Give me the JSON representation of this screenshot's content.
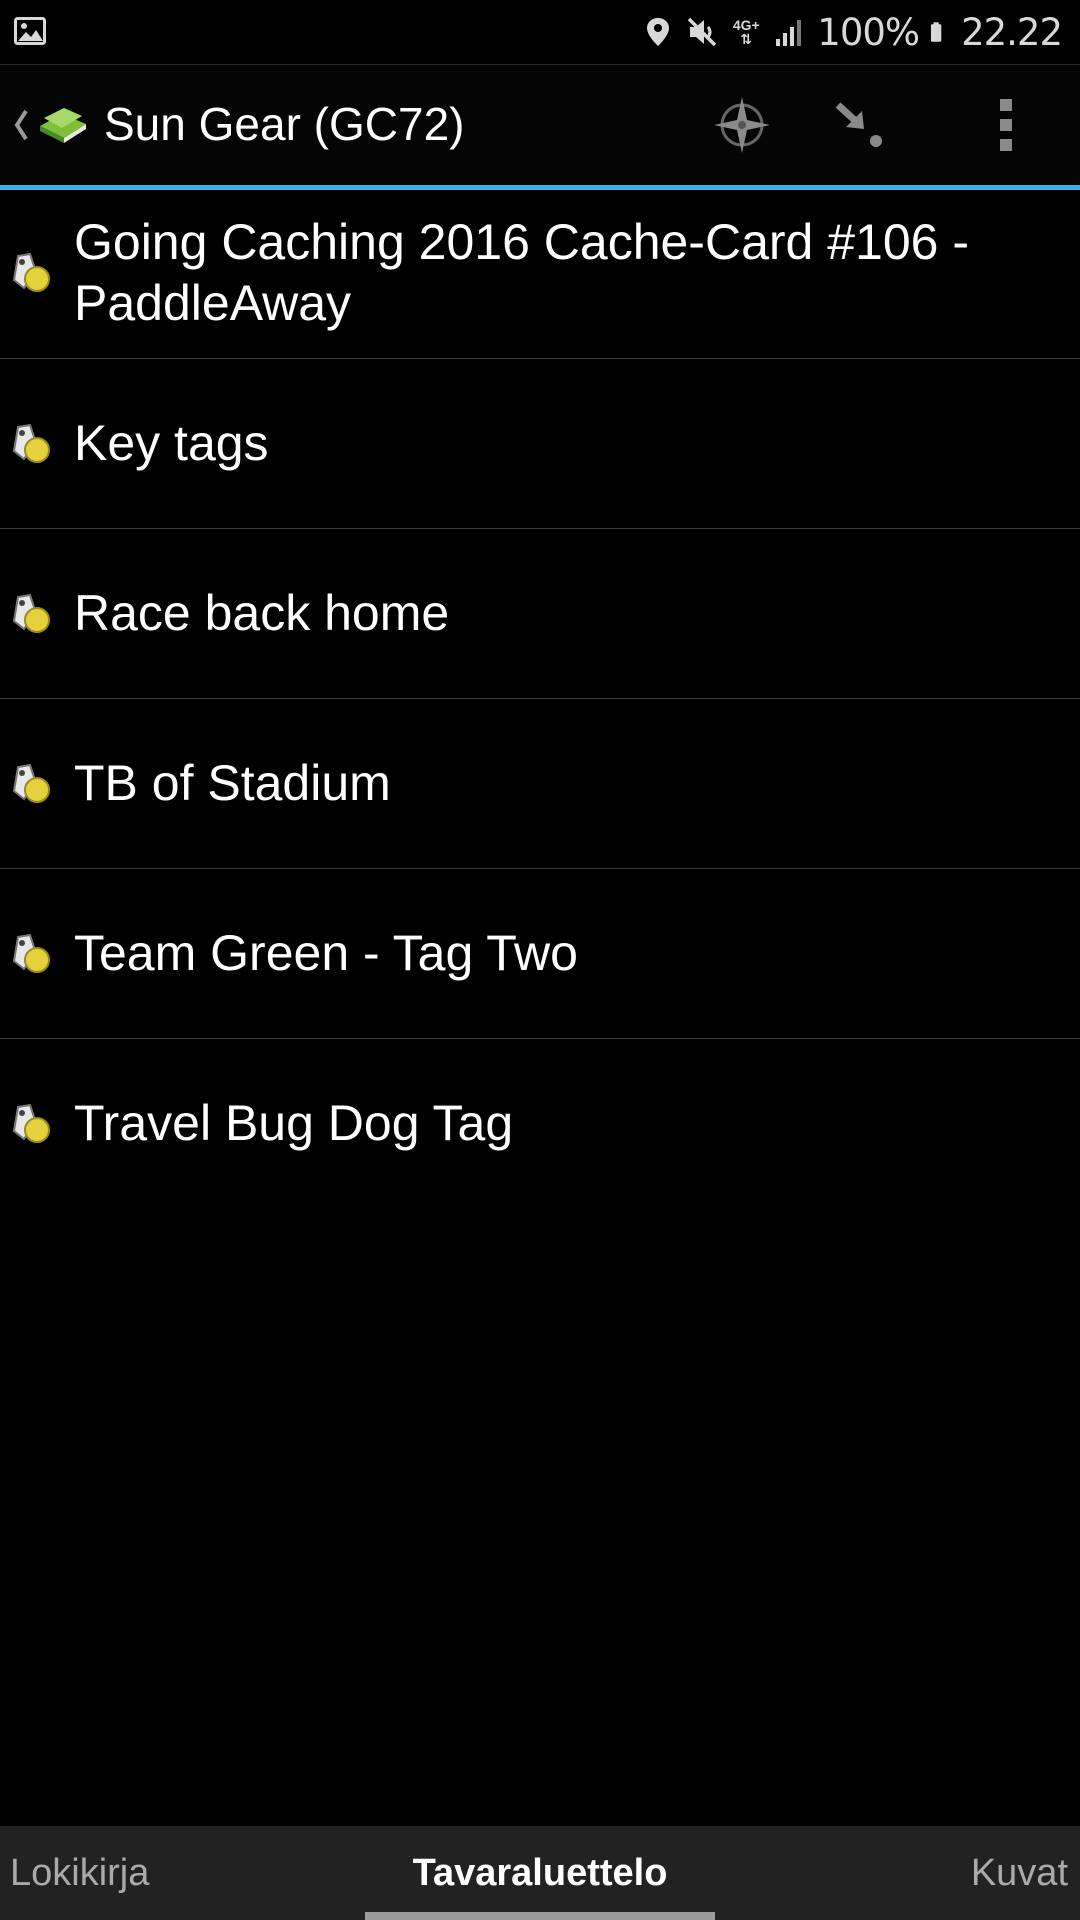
{
  "status_bar": {
    "battery_text": "100%",
    "time": "22.22",
    "network_label": "4G+",
    "icons": [
      "gallery-icon",
      "location-icon",
      "mute-icon",
      "network-4g-icon",
      "signal-icon",
      "battery-icon"
    ]
  },
  "action_bar": {
    "title": "Sun Gear (GC72)",
    "icons": [
      "back-chevron-icon",
      "book-icon",
      "compass-icon",
      "navigate-icon",
      "overflow-menu-icon"
    ],
    "accent_color": "#33b5e5"
  },
  "inventory": {
    "items": [
      {
        "label": "Going Caching 2016 Cache-Card #106 - PaddleAway",
        "icon": "trackable-icon"
      },
      {
        "label": "Key tags",
        "icon": "trackable-icon"
      },
      {
        "label": "Race back home",
        "icon": "trackable-icon"
      },
      {
        "label": "TB of Stadium",
        "icon": "trackable-icon"
      },
      {
        "label": "Team Green - Tag Two",
        "icon": "trackable-icon"
      },
      {
        "label": "Travel Bug Dog Tag",
        "icon": "trackable-icon"
      }
    ]
  },
  "tabs": {
    "left": "Lokikirja",
    "center": "Tavaraluettelo",
    "right": "Kuvat",
    "selected": "Tavaraluettelo"
  }
}
